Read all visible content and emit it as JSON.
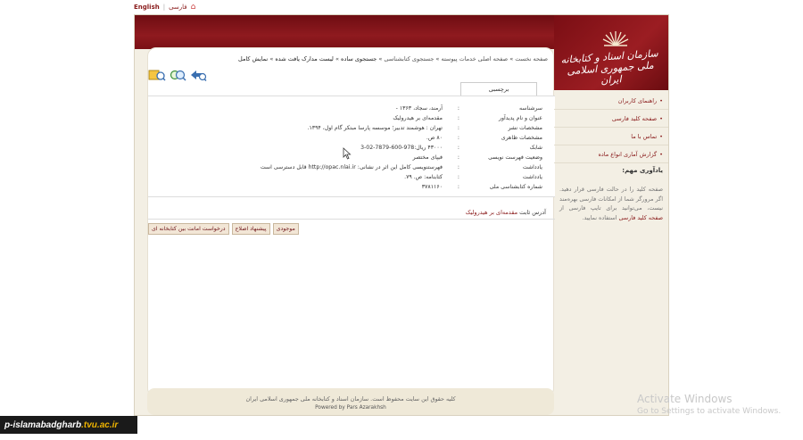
{
  "topbar": {
    "english": "English",
    "farsi": "فارسی",
    "separator": "|",
    "home_icon": "home-icon"
  },
  "header": {
    "logo_text": "سازمان اسناد و کتابخانه ملی جمهوری اسلامی ایران",
    "brand_color": "#8a1c1c"
  },
  "breadcrumb": {
    "items": [
      "صفحه نخست",
      "صفحه اصلی خدمات پیوسته",
      "جستجوی کتابشناسی",
      "جستجوی ساده",
      "لیست مدارک یافت شده",
      "نمایش کامل"
    ],
    "separator": "»"
  },
  "toolbar": {
    "icons": [
      "back-arrow-icon",
      "zoom-icon",
      "add-to-list-icon"
    ]
  },
  "tab": {
    "label": "برچسبی"
  },
  "record": {
    "rows": [
      {
        "label": "سرشناسه",
        "value": "آرمند، سجاد، ۱۳۶۳ -"
      },
      {
        "label": "عنوان و نام پدیدآور",
        "value": "مقدمه‌ای بر هیدرولیک"
      },
      {
        "label": "مشخصات نشر",
        "value": "تهران : هوشمند تدبیر؛ موسسه پارسا مبتکر گام اول، ۱۳۹۴."
      },
      {
        "label": "مشخصات ظاهری",
        "value": "۸۰ ص."
      },
      {
        "label": "شابک",
        "value": "۴۳۰۰۰ ریال:978-600-7879-02-3"
      },
      {
        "label": "وضعیت فهرست نویسی",
        "value": "فیپای مختصر"
      },
      {
        "label": "یادداشت",
        "value": "فهرستنویسی کامل این اثر در نشانی: http://opac.nlai.ir قابل دسترسی است"
      },
      {
        "label": "یادداشت",
        "value": "کتابنامه: ص. ۷۹."
      },
      {
        "label": "شماره کتابشناسی ملی",
        "value": "۳۷۸۱۱۶۰"
      }
    ],
    "colon": ":"
  },
  "permalink": {
    "label": "آدرس ثابت",
    "value": "مقدمه‌ای بر هیدرولیک"
  },
  "actions": {
    "inventory": "موجودی",
    "suggest": "پیشنهاد اصلاح",
    "ill": "درخواست امانت بین کتابخانه ای"
  },
  "sidebar": {
    "items": [
      "راهنمای کاربران",
      "صفحه کلید فارسی",
      "تماس با ما",
      "گزارش آماری انواع ماده"
    ],
    "note_title": "یادآوری مهم:",
    "note_text_1": "صفحه کلید را در حالت فارسی قرار دهید. اگر مرورگر شما از امکانات فارسی بهره‌مند نیست، می‌توانید برای تایپ فارسی از",
    "note_highlight": "صفحه کلید فارسی",
    "note_text_2": "استفاده نمایید."
  },
  "footer": {
    "copyright": "کلیه حقوق این سایت محفوظ است. سازمان اسناد و کتابخانه ملی جمهوری اسلامی ایران",
    "powered": "Powered by Pars Azarakhsh"
  },
  "watermark": {
    "title": "Activate Windows",
    "subtitle": "Go to Settings to activate Windows."
  },
  "badge": {
    "prefix": "p-islamabadgharb",
    "suffix": ".tvu.ac.ir"
  }
}
